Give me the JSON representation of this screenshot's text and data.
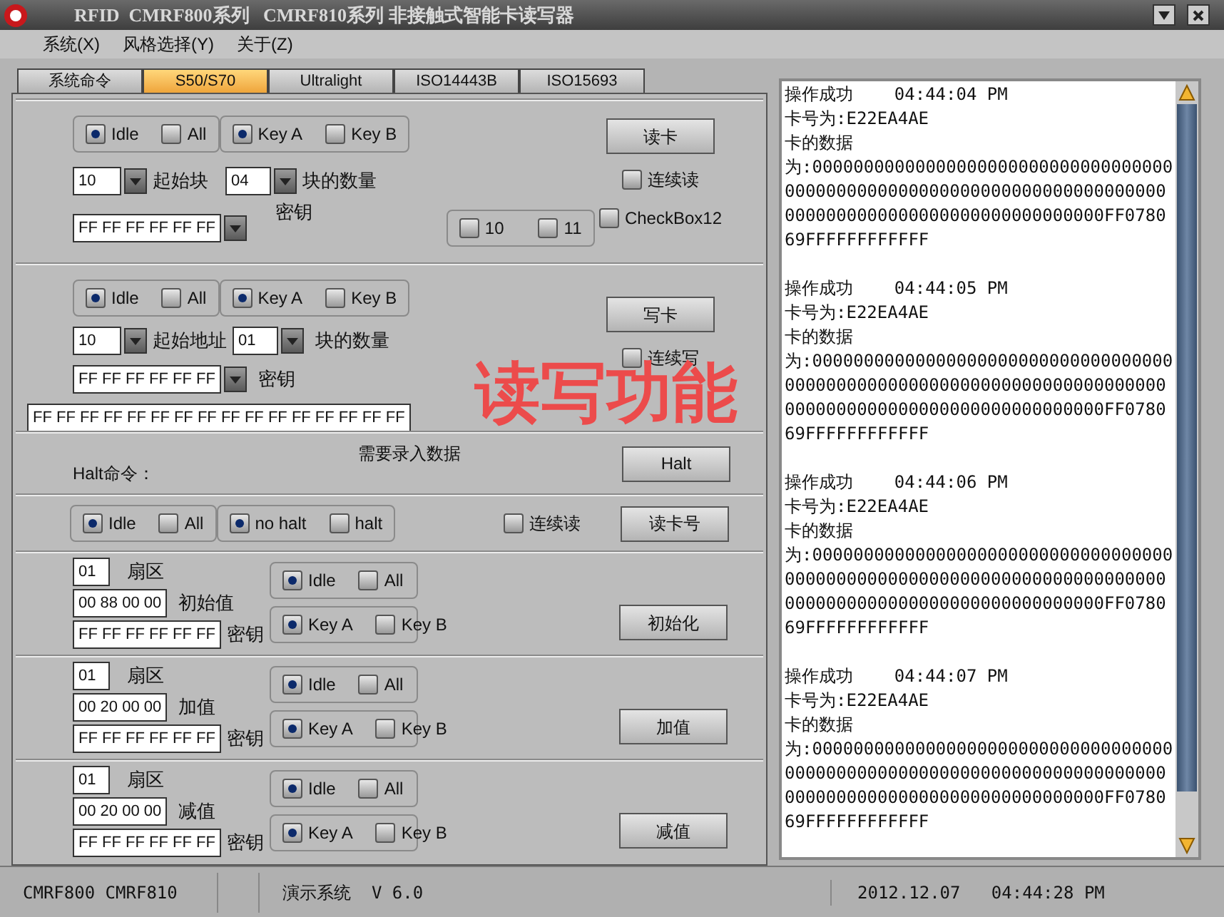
{
  "window": {
    "title": "RFID  CMRF800系列   CMRF810系列 非接触式智能卡读写器"
  },
  "menu": [
    "系统(X)",
    "风格选择(Y)",
    "关于(Z)"
  ],
  "tabs": [
    {
      "label": "系统命令",
      "selected": false
    },
    {
      "label": "S50/S70",
      "selected": true
    },
    {
      "label": "Ultralight",
      "selected": false
    },
    {
      "label": "ISO14443B",
      "selected": false
    },
    {
      "label": "ISO15693",
      "selected": false
    }
  ],
  "read_card": {
    "mode_options": [
      {
        "label": "Idle",
        "selected": true
      },
      {
        "label": "All",
        "selected": false
      }
    ],
    "key_options": [
      {
        "label": "Key A",
        "selected": true
      },
      {
        "label": "Key B",
        "selected": false
      }
    ],
    "start_block": {
      "value": "10",
      "label": "起始块"
    },
    "block_count": {
      "value": "04",
      "label": "块的数量"
    },
    "key": {
      "value": "FF FF FF FF FF FF",
      "label": "密钥"
    },
    "extra_checks": [
      {
        "label": "10",
        "checked": false
      },
      {
        "label": "11",
        "checked": false
      }
    ],
    "button": "读卡",
    "continuous": {
      "label": "连续读",
      "checked": false
    },
    "checkbox12": {
      "label": "CheckBox12",
      "checked": false
    }
  },
  "write_card": {
    "mode_options": [
      {
        "label": "Idle",
        "selected": true
      },
      {
        "label": "All",
        "selected": false
      }
    ],
    "key_options": [
      {
        "label": "Key A",
        "selected": true
      },
      {
        "label": "Key B",
        "selected": false
      }
    ],
    "start_address": {
      "value": "10",
      "label": "起始地址"
    },
    "block_count": {
      "value": "01",
      "label": "块的数量"
    },
    "key": {
      "value": "FF FF FF FF FF FF",
      "label": "密钥"
    },
    "data": "FF FF FF FF FF FF FF FF FF FF FF FF FF FF FF FF",
    "button": "写卡",
    "continuous": {
      "label": "连续写",
      "checked": false
    }
  },
  "annotation": "读写功能",
  "halt": {
    "label": "Halt命令：",
    "note": "需要录入数据",
    "button": "Halt"
  },
  "read_number": {
    "mode_options": [
      {
        "label": "Idle",
        "selected": true
      },
      {
        "label": "All",
        "selected": false
      }
    ],
    "halt_options": [
      {
        "label": "no halt",
        "selected": true
      },
      {
        "label": "halt",
        "selected": false
      }
    ],
    "continuous": {
      "label": "连续读",
      "checked": false
    },
    "button": "读卡号"
  },
  "value_ops": [
    {
      "sector": {
        "value": "01",
        "label": "扇区"
      },
      "amount": {
        "value": "00 88 00 00",
        "label": "初始值"
      },
      "key": {
        "value": "FF FF FF FF FF FF",
        "label": "密钥"
      },
      "mode_options": [
        {
          "label": "Idle",
          "selected": true
        },
        {
          "label": "All",
          "selected": false
        }
      ],
      "key_options": [
        {
          "label": "Key A",
          "selected": true
        },
        {
          "label": "Key B",
          "selected": false
        }
      ],
      "button": "初始化"
    },
    {
      "sector": {
        "value": "01",
        "label": "扇区"
      },
      "amount": {
        "value": "00 20 00 00",
        "label": "加值"
      },
      "key": {
        "value": "FF FF FF FF FF FF",
        "label": "密钥"
      },
      "mode_options": [
        {
          "label": "Idle",
          "selected": true
        },
        {
          "label": "All",
          "selected": false
        }
      ],
      "key_options": [
        {
          "label": "Key A",
          "selected": true
        },
        {
          "label": "Key B",
          "selected": false
        }
      ],
      "button": "加值"
    },
    {
      "sector": {
        "value": "01",
        "label": "扇区"
      },
      "amount": {
        "value": "00 20 00 00",
        "label": "减值"
      },
      "key": {
        "value": "FF FF FF FF FF FF",
        "label": "密钥"
      },
      "mode_options": [
        {
          "label": "Idle",
          "selected": true
        },
        {
          "label": "All",
          "selected": false
        }
      ],
      "key_options": [
        {
          "label": "Key A",
          "selected": true
        },
        {
          "label": "Key B",
          "selected": false
        }
      ],
      "button": "减值"
    }
  ],
  "log": [
    {
      "lines": [
        "操作成功    04:44:04 PM",
        "卡号为:E22EA4AE",
        "卡的数据",
        "为:00000000000000000000000000000000000",
        "0000000000000000000000000000000000000",
        "0000000000000000000000000000000FF0780",
        "69FFFFFFFFFFFF"
      ]
    },
    {
      "lines": [
        "操作成功    04:44:05 PM",
        "卡号为:E22EA4AE",
        "卡的数据",
        "为:00000000000000000000000000000000000",
        "0000000000000000000000000000000000000",
        "0000000000000000000000000000000FF0780",
        "69FFFFFFFFFFFF"
      ]
    },
    {
      "lines": [
        "操作成功    04:44:06 PM",
        "卡号为:E22EA4AE",
        "卡的数据",
        "为:00000000000000000000000000000000000",
        "0000000000000000000000000000000000000",
        "0000000000000000000000000000000FF0780",
        "69FFFFFFFFFFFF"
      ]
    },
    {
      "lines": [
        "操作成功    04:44:07 PM",
        "卡号为:E22EA4AE",
        "卡的数据",
        "为:00000000000000000000000000000000000",
        "0000000000000000000000000000000000000",
        "0000000000000000000000000000000FF0780",
        "69FFFFFFFFFFFF"
      ]
    }
  ],
  "status_bar": [
    "CMRF800 CMRF810",
    "演示系统  V 6.0",
    "2012.12.07   04:44:28 PM"
  ]
}
